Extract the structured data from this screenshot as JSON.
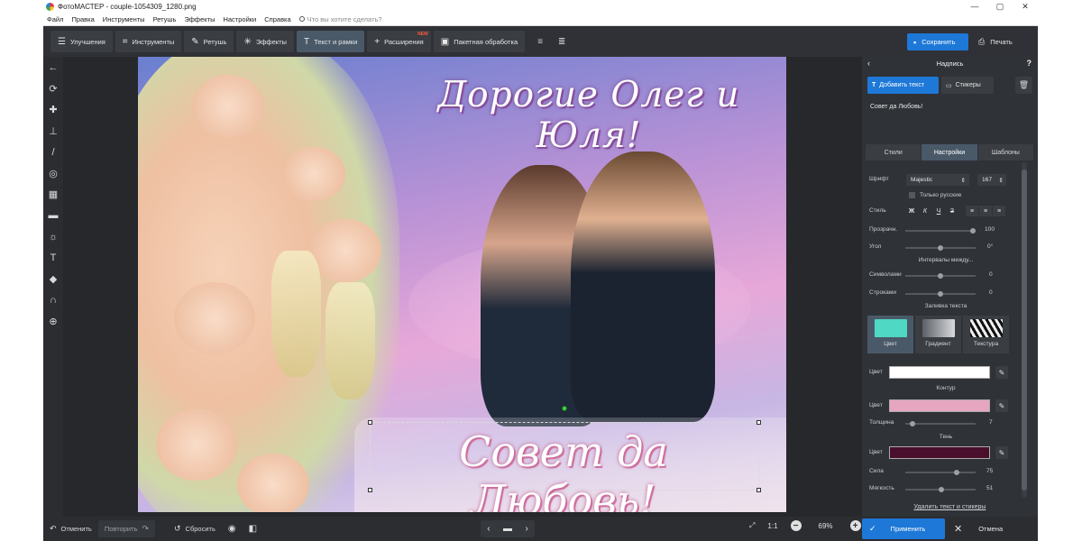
{
  "window": {
    "title": "ФотоМАСТЕР - couple-1054309_1280.png",
    "controls": [
      "—",
      "▢",
      "✕"
    ]
  },
  "menu": {
    "items": [
      "Файл",
      "Правка",
      "Инструменты",
      "Ретушь",
      "Эффекты",
      "Настройки",
      "Справка"
    ],
    "search_placeholder": "Что вы хотите сделать?"
  },
  "toolbar": {
    "buttons": [
      {
        "label": "Улучшения",
        "icon": "sliders-icon"
      },
      {
        "label": "Инструменты",
        "icon": "crop-icon"
      },
      {
        "label": "Ретушь",
        "icon": "brush-icon"
      },
      {
        "label": "Эффекты",
        "icon": "sparkle-icon"
      },
      {
        "label": "Текст и рамки",
        "icon": "text-icon"
      },
      {
        "label": "Расширения",
        "icon": "plus-icon",
        "badge": "NEW"
      },
      {
        "label": "Пакетная обработка",
        "icon": "batch-icon"
      }
    ],
    "active": "Текст и рамки",
    "save_label": "Сохранить",
    "print_label": "Печать"
  },
  "canvas": {
    "headline": "Дорогие Олег и Юля!",
    "selected_text": "Совет да Любовь!"
  },
  "bottombar": {
    "undo_label": "Отменить",
    "redo_label": "Повторить",
    "reset_label": "Сбросить",
    "ratio_label": "1:1",
    "zoom_value": "69%"
  },
  "panel": {
    "title": "Надпись",
    "add_text_label": "Добавить текст",
    "stickers_label": "Стикеры",
    "text_value": "Совет да Любовь!",
    "tabs": [
      "Стили",
      "Настройки",
      "Шаблоны"
    ],
    "active_tab": "Настройки",
    "font_label": "Шрифт",
    "font_value": "Majestic",
    "font_size": "167",
    "only_russian_label": "Только русские",
    "style_label": "Стиль",
    "style_buttons": [
      "Ж",
      "К",
      "Ч",
      "З"
    ],
    "opacity_label": "Прозрачн.",
    "opacity_value": "100",
    "opacity_level": 1.0,
    "angle_label": "Угол",
    "angle_value": "0°",
    "angle_level": 0.5,
    "intervals_label": "Интервалы между...",
    "chars_label": "Символами",
    "chars_value": "0",
    "chars_level": 0.5,
    "lines_label": "Строками",
    "lines_value": "0",
    "lines_level": 0.5,
    "fill_label": "Заливка текста",
    "fill_options": [
      "Цвет",
      "Градиент",
      "Текстура"
    ],
    "fill_color_label": "Цвет",
    "fill_color": "#ffffff",
    "outline_label": "Контур",
    "outline_color_label": "Цвет",
    "outline_color": "#e6a6c0",
    "thickness_label": "Толщина",
    "thickness_value": "7",
    "thickness_level": 0.07,
    "shadow_label": "Тень",
    "shadow_color_label": "Цвет",
    "shadow_color": "#4a0f2c",
    "strength_label": "Сила",
    "strength_value": "75",
    "strength_level": 0.75,
    "softness_label": "Мягкость",
    "softness_value": "51",
    "softness_level": 0.51,
    "remove_link": "Удалить текст и стикеры",
    "apply_label": "Применить",
    "cancel_label": "Отмена"
  },
  "colors": {
    "accent": "#1e78d7",
    "app_bg": "#2b2d30",
    "active_tab": "#4a5968",
    "fill_swatch": "#4fd8c4"
  }
}
